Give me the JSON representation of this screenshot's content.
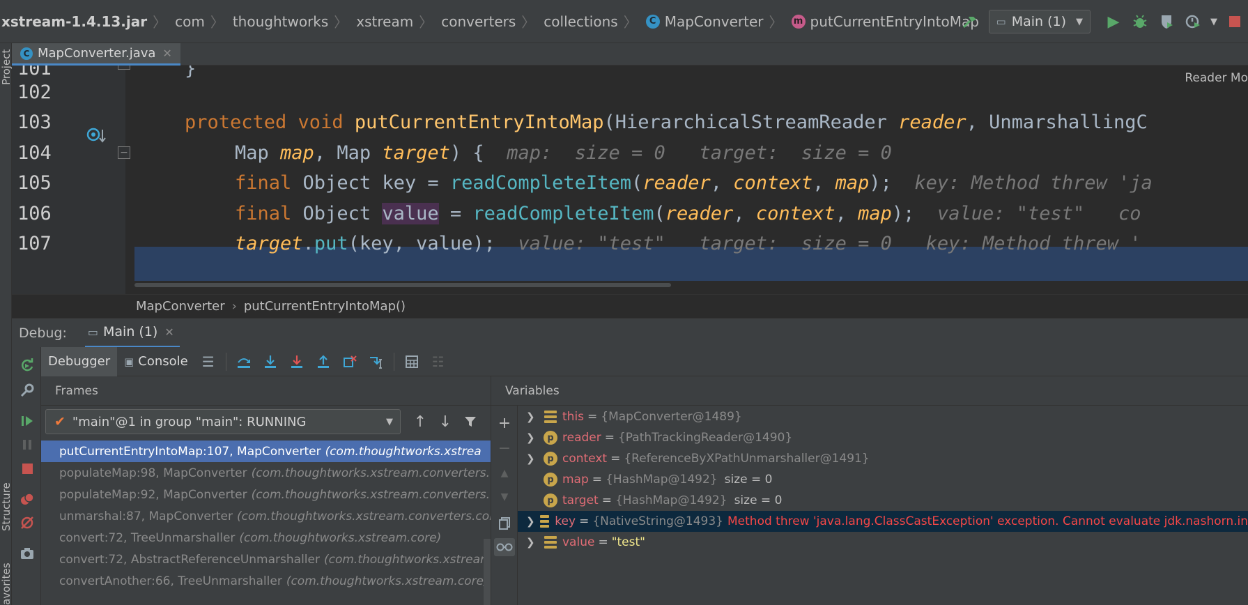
{
  "navbar": {
    "breadcrumbs": [
      "xstream-1.4.13.jar",
      "com",
      "thoughtworks",
      "xstream",
      "converters",
      "collections"
    ],
    "class_crumb": "MapConverter",
    "method_crumb": "putCurrentEntryIntoMap",
    "run_config": "Main (1)"
  },
  "left_strip": {
    "project_label": "Project",
    "structure_label": "Structure",
    "favorites_label": "avorites"
  },
  "editor": {
    "tab_title": "MapConverter.java",
    "reader_mode": "Reader Mo",
    "line_numbers": [
      "101",
      "102",
      "103",
      "104",
      "105",
      "106",
      "107"
    ],
    "lines": {
      "l101": "}",
      "l103_kw": "protected void ",
      "l103_fn": "putCurrentEntryIntoMap",
      "l103_rest1": "(HierarchicalStreamReader ",
      "l103_param": "reader",
      "l103_rest2": ", UnmarshallingC",
      "l104_type1": "Map ",
      "l104_p1": "map",
      "l104_mid": ", Map ",
      "l104_p2": "target",
      "l104_end": ") {",
      "l104_hint": "map:  size = 0   target:  size = 0",
      "l105_kw": "final ",
      "l105_decl": "Object key = ",
      "l105_call": "readCompleteItem",
      "l105_open": "(",
      "l105_a1": "reader",
      "l105_c1": ", ",
      "l105_a2": "context",
      "l105_c2": ", ",
      "l105_a3": "map",
      "l105_close": ");",
      "l105_hint": "key: Method threw 'ja",
      "l106_kw": "final ",
      "l106_decl1": "Object ",
      "l106_var": "value",
      "l106_decl2": " = ",
      "l106_call": "readCompleteItem",
      "l106_open": "(",
      "l106_a1": "reader",
      "l106_c1": ", ",
      "l106_a2": "context",
      "l106_c2": ", ",
      "l106_a3": "map",
      "l106_close": ");",
      "l106_hint": "value: \"test\"   co",
      "l107_target": "target",
      "l107_dot": ".",
      "l107_call": "put",
      "l107_args": "(key, value);",
      "l107_hint": "value: \"test\"   target:  size = 0   key: Method threw '"
    },
    "crumbs": [
      "MapConverter",
      "putCurrentEntryIntoMap()"
    ]
  },
  "debug": {
    "title": "Debug:",
    "session_tab": "Main (1)",
    "tab_debugger": "Debugger",
    "tab_console": "Console",
    "frames_title": "Frames",
    "thread": "\"main\"@1 in group \"main\": RUNNING",
    "frames": [
      {
        "method": "putCurrentEntryIntoMap:107, MapConverter",
        "pkg": "(com.thoughtworks.xstrea"
      },
      {
        "method": "populateMap:98, MapConverter",
        "pkg": "(com.thoughtworks.xstream.converters."
      },
      {
        "method": "populateMap:92, MapConverter",
        "pkg": "(com.thoughtworks.xstream.converters."
      },
      {
        "method": "unmarshal:87, MapConverter",
        "pkg": "(com.thoughtworks.xstream.converters.coll"
      },
      {
        "method": "convert:72, TreeUnmarshaller",
        "pkg": "(com.thoughtworks.xstream.core)"
      },
      {
        "method": "convert:72, AbstractReferenceUnmarshaller",
        "pkg": "(com.thoughtworks.xstream."
      },
      {
        "method": "convertAnother:66, TreeUnmarshaller",
        "pkg": "(com.thoughtworks.xstream.core)"
      }
    ],
    "variables_title": "Variables",
    "variables": [
      {
        "name": "this",
        "value": "{MapConverter@1489}",
        "extra": "",
        "error": ""
      },
      {
        "name": "reader",
        "value": "{PathTrackingReader@1490}",
        "extra": "",
        "error": ""
      },
      {
        "name": "context",
        "value": "{ReferenceByXPathUnmarshaller@1491}",
        "extra": "",
        "error": ""
      },
      {
        "name": "map",
        "value": "{HashMap@1492}",
        "extra": "size = 0",
        "error": ""
      },
      {
        "name": "target",
        "value": "{HashMap@1492}",
        "extra": "size = 0",
        "error": ""
      },
      {
        "name": "key",
        "value": "{NativeString@1493}",
        "extra": "",
        "error": "Method threw 'java.lang.ClassCastException' exception. Cannot evaluate jdk.nashorn.in"
      },
      {
        "name": "value",
        "value": "\"test\"",
        "extra": "",
        "error": ""
      }
    ]
  },
  "colors": {
    "accent": "#4a88c7",
    "selected_frame": "#4b6eaf",
    "exec_line": "#2d4a75",
    "error_text": "#f44747",
    "keyword": "#cc7832"
  }
}
